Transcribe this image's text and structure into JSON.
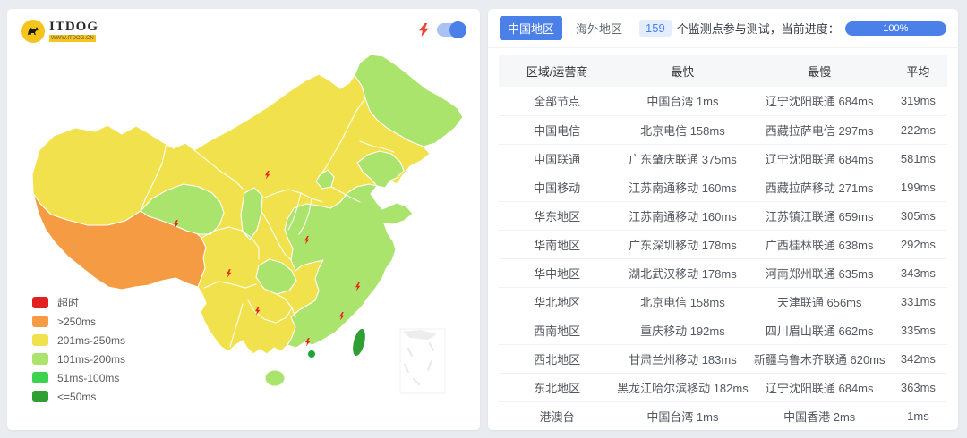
{
  "colors": {
    "accent_blue": "#4a80e8",
    "badge_bg": "#e4edfb",
    "yellow": "#f1e24d",
    "light_green": "#abe46d",
    "orange": "#f49b44",
    "green": "#3bd34f",
    "dark_green": "#2f9e33",
    "timeout_red": "#e22020",
    "bolt_red": "#e8281e"
  },
  "logo": {
    "title": "ITDOG",
    "subtitle": "WWW.ITDOG.CN"
  },
  "map_panel": {
    "legend": [
      {
        "label": "超时",
        "color": "#e22020"
      },
      {
        "label": ">250ms",
        "color": "#f49b44"
      },
      {
        "label": "201ms-250ms",
        "color": "#f1e24d"
      },
      {
        "label": "101ms-200ms",
        "color": "#abe46d"
      },
      {
        "label": "51ms-100ms",
        "color": "#3bd34f"
      },
      {
        "label": "<=50ms",
        "color": "#2f9e33"
      }
    ]
  },
  "results_panel": {
    "tabs": [
      {
        "label": "中国地区",
        "active": true
      },
      {
        "label": "海外地区",
        "active": false
      }
    ],
    "monitor_count": "159",
    "progress_text": "个监测点参与测试，当前进度：",
    "progress_value": "100%",
    "table": {
      "headers": [
        "区域/运营商",
        "最快",
        "最慢",
        "平均"
      ],
      "rows": [
        [
          "全部节点",
          "中国台湾 1ms",
          "辽宁沈阳联通 684ms",
          "319ms"
        ],
        [
          "中国电信",
          "北京电信 158ms",
          "西藏拉萨电信 297ms",
          "222ms"
        ],
        [
          "中国联通",
          "广东肇庆联通 375ms",
          "辽宁沈阳联通 684ms",
          "581ms"
        ],
        [
          "中国移动",
          "江苏南通移动 160ms",
          "西藏拉萨移动 271ms",
          "199ms"
        ],
        [
          "华东地区",
          "江苏南通移动 160ms",
          "江苏镇江联通 659ms",
          "305ms"
        ],
        [
          "华南地区",
          "广东深圳移动 178ms",
          "广西桂林联通 638ms",
          "292ms"
        ],
        [
          "华中地区",
          "湖北武汉移动 178ms",
          "河南郑州联通 635ms",
          "343ms"
        ],
        [
          "华北地区",
          "北京电信 158ms",
          "天津联通 656ms",
          "331ms"
        ],
        [
          "西南地区",
          "重庆移动 192ms",
          "四川眉山联通 662ms",
          "335ms"
        ],
        [
          "西北地区",
          "甘肃兰州移动 183ms",
          "新疆乌鲁木齐联通 620ms",
          "342ms"
        ],
        [
          "东北地区",
          "黑龙江哈尔滨移动 182ms",
          "辽宁沈阳联通 684ms",
          "363ms"
        ],
        [
          "港澳台",
          "中国台湾 1ms",
          "中国香港 2ms",
          "1ms"
        ]
      ]
    }
  }
}
